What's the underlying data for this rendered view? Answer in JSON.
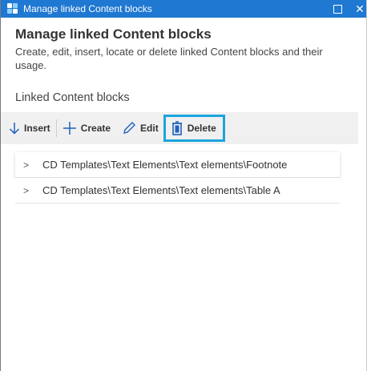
{
  "window": {
    "title": "Manage linked Content blocks"
  },
  "header": {
    "title": "Manage linked Content blocks",
    "description": "Create, edit, insert, locate or delete linked Content blocks and their usage."
  },
  "section": {
    "label": "Linked Content blocks"
  },
  "toolbar": {
    "insert_label": "Insert",
    "create_label": "Create",
    "edit_label": "Edit",
    "delete_label": "Delete",
    "highlight_color": "#1aa5dd"
  },
  "items": [
    {
      "label": "CD Templates\\Text Elements\\Text elements\\Footnote"
    },
    {
      "label": "CD Templates\\Text Elements\\Text elements\\Table A"
    }
  ],
  "colors": {
    "titlebar": "#1f78d1",
    "toolbar_bg": "#f0f0f0"
  }
}
